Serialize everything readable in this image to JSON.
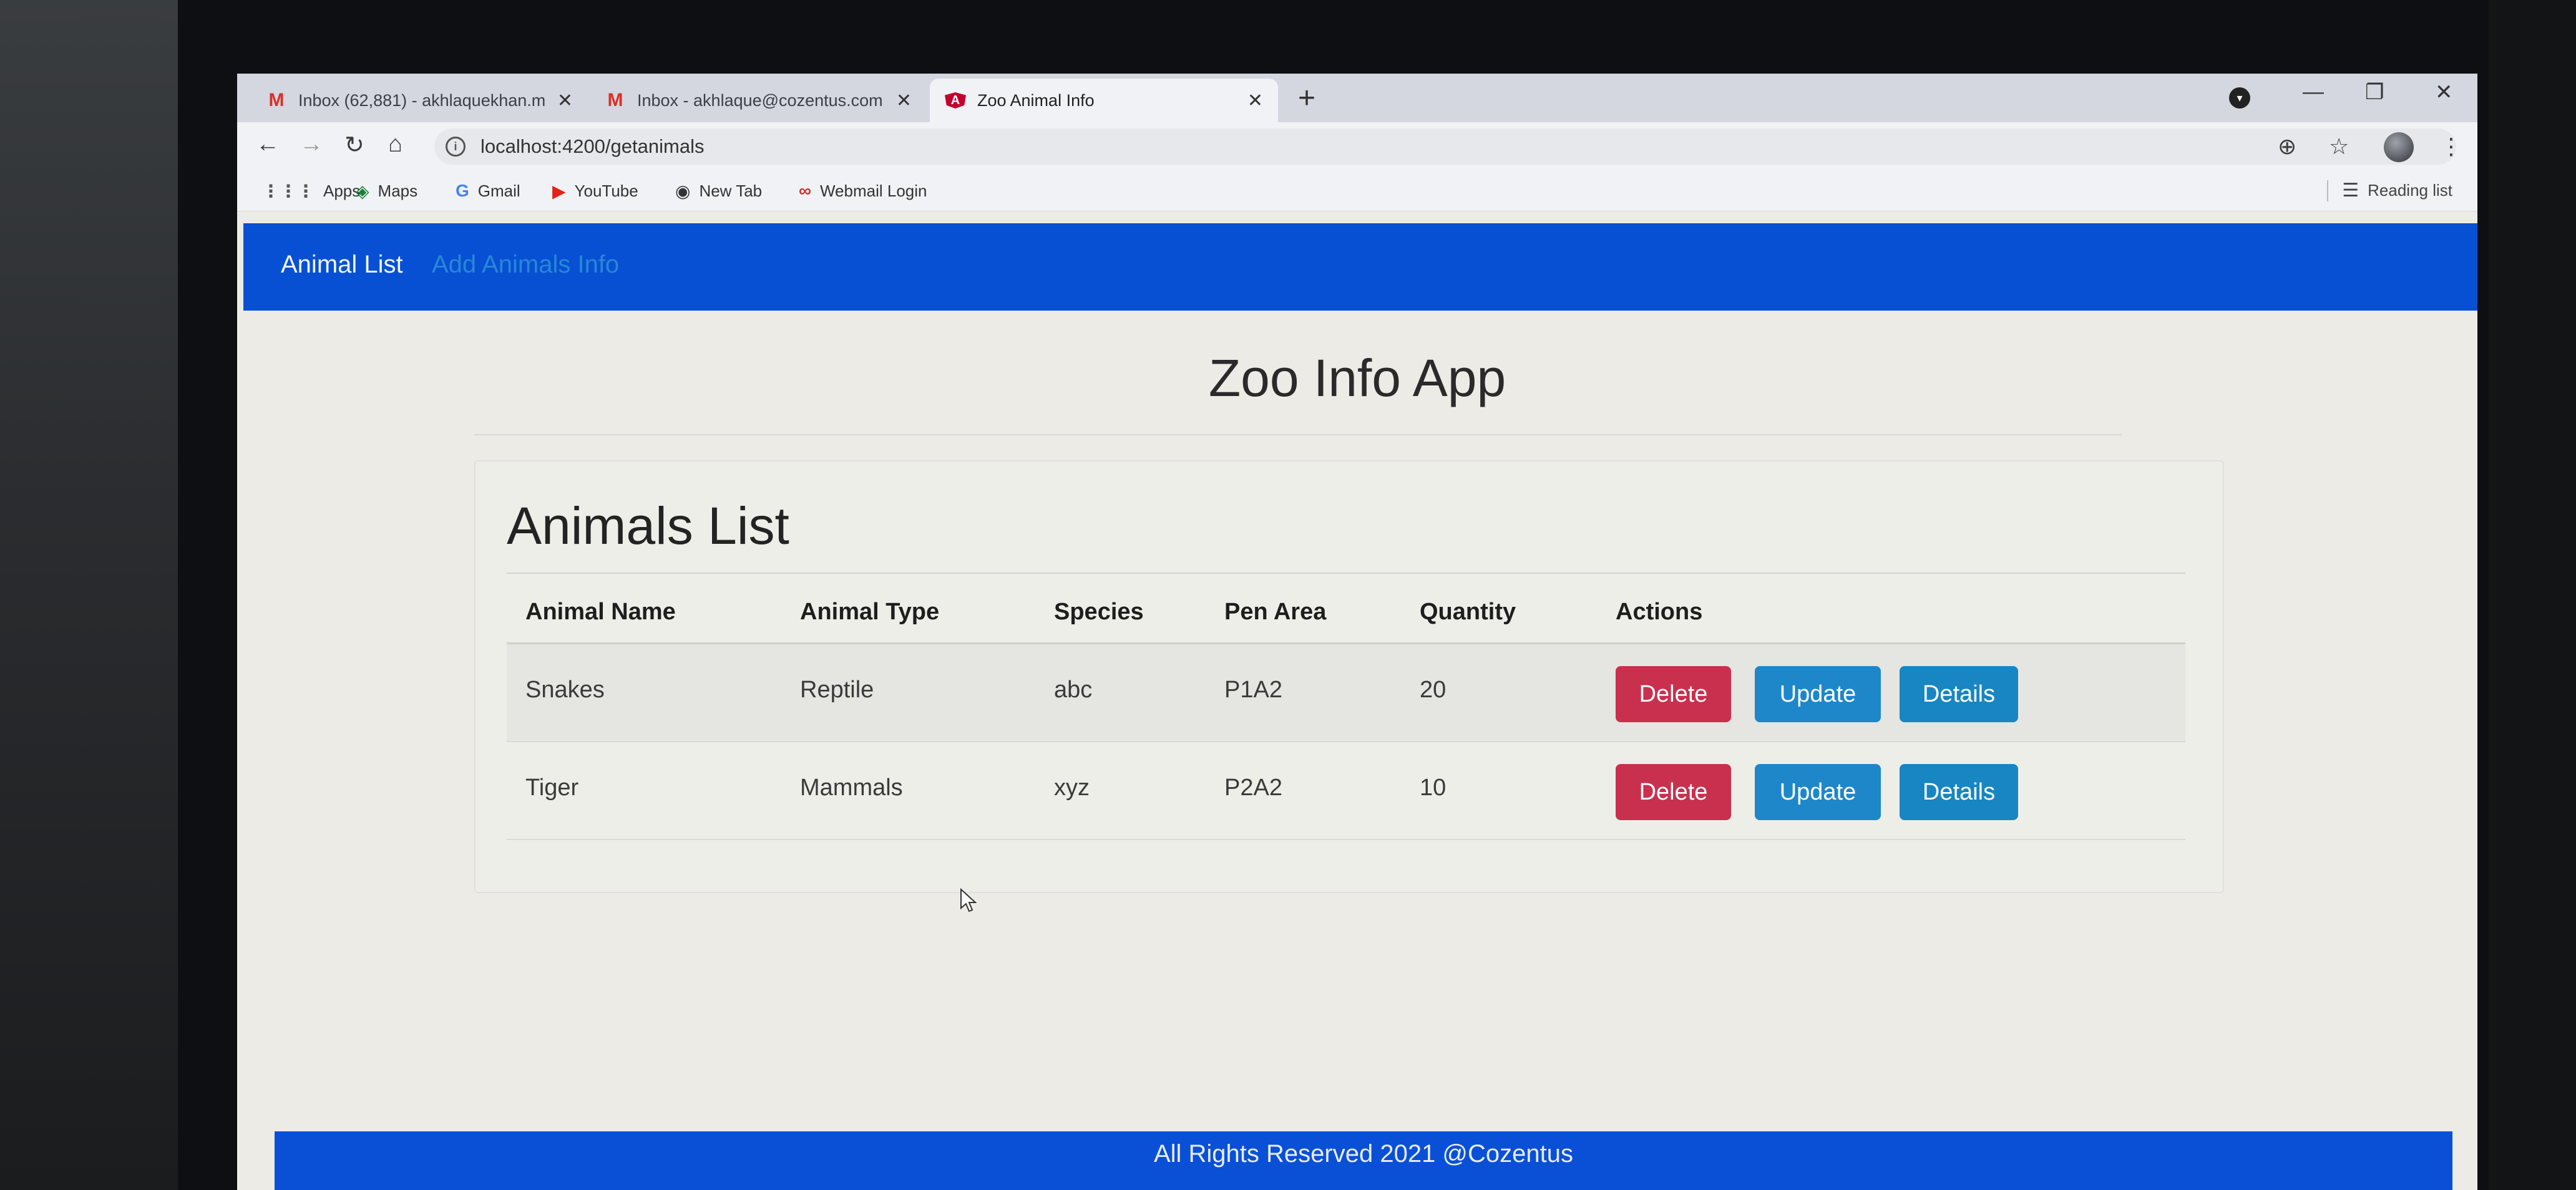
{
  "browser": {
    "tabs": [
      {
        "title": "Inbox (62,881) - akhlaquekhan.m",
        "icon": "gmail-icon"
      },
      {
        "title": "Inbox - akhlaque@cozentus.com",
        "icon": "gmail-icon"
      },
      {
        "title": "Zoo Animal Info",
        "icon": "angular-icon"
      }
    ],
    "url": "localhost:4200/getanimals",
    "bookmarks": [
      {
        "label": "Apps",
        "icon": "apps-grid-icon"
      },
      {
        "label": "Maps",
        "icon": "maps-icon"
      },
      {
        "label": "Gmail",
        "icon": "google-icon"
      },
      {
        "label": "YouTube",
        "icon": "youtube-icon"
      },
      {
        "label": "New Tab",
        "icon": "globe-icon"
      },
      {
        "label": "Webmail Login",
        "icon": "webmail-icon"
      }
    ],
    "reading_list": "Reading list"
  },
  "nav": {
    "brand": "Animal List",
    "link": "Add Animals Info"
  },
  "app_title": "Zoo Info App",
  "card_title": "Animals List",
  "table": {
    "headers": [
      "Animal Name",
      "Animal Type",
      "Species",
      "Pen Area",
      "Quantity",
      "Actions"
    ],
    "rows": [
      {
        "name": "Snakes",
        "type": "Reptile",
        "species": "abc",
        "pen": "P1A2",
        "qty": "20"
      },
      {
        "name": "Tiger",
        "type": "Mammals",
        "species": "xyz",
        "pen": "P2A2",
        "qty": "10"
      }
    ],
    "actions": {
      "delete": "Delete",
      "update": "Update",
      "details": "Details"
    }
  },
  "footer": "All Rights Reserved 2021 @Cozentus",
  "colors": {
    "navbar": "#0750d4",
    "delete": "#c9304e",
    "update": "#1d87c9",
    "details": "#1786c2"
  }
}
